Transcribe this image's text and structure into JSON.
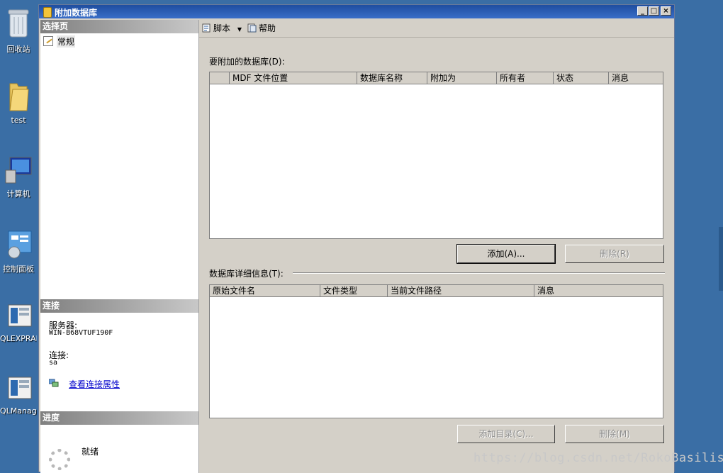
{
  "desktop": {
    "icons": [
      {
        "label": "回收站",
        "icon": "recycle-bin-icon"
      },
      {
        "label": "test",
        "icon": "folder-icon"
      },
      {
        "label": "计算机",
        "icon": "computer-icon"
      },
      {
        "label": "控制面板",
        "icon": "control-panel-icon"
      },
      {
        "label": "QLEXPRAD",
        "icon": "app-shortcut-icon"
      },
      {
        "label": "QLManage",
        "icon": "app-shortcut-icon"
      }
    ]
  },
  "window": {
    "title": "附加数据库",
    "controls": {
      "minimize": "_",
      "maximize": "□",
      "close": "×"
    }
  },
  "left_pane": {
    "select_page_header": "选择页",
    "pages": [
      {
        "label": "常规"
      }
    ],
    "connection_header": "连接",
    "server_label": "服务器:",
    "server_value": "WIN-B68VTUF190F",
    "connection_label": "连接:",
    "connection_value": "sa",
    "view_connection_link": "查看连接属性",
    "progress_header": "进度",
    "progress_status": "就绪"
  },
  "toolbar": {
    "script_label": "脚本",
    "help_label": "帮助"
  },
  "attach_section": {
    "label": "要附加的数据库(D):",
    "columns": [
      "",
      "MDF 文件位置",
      "数据库名称",
      "附加为",
      "所有者",
      "状态",
      "消息"
    ],
    "rows": [],
    "add_button": "添加(A)...",
    "remove_button": "删除(R)"
  },
  "details_section": {
    "label": "数据库详细信息(T):",
    "columns": [
      "原始文件名",
      "文件类型",
      "当前文件路径",
      "消息"
    ],
    "rows": [],
    "add_catalog_button": "添加目录(C)...",
    "remove_button": "删除(M)"
  },
  "watermark": "https://blog.csdn.net/RokoBasilisk",
  "colors": {
    "desktop": "#3a6ea5",
    "titlebar": "#1f4ea0",
    "dialog_bg": "#d4d0c8",
    "link": "#0000cc"
  }
}
